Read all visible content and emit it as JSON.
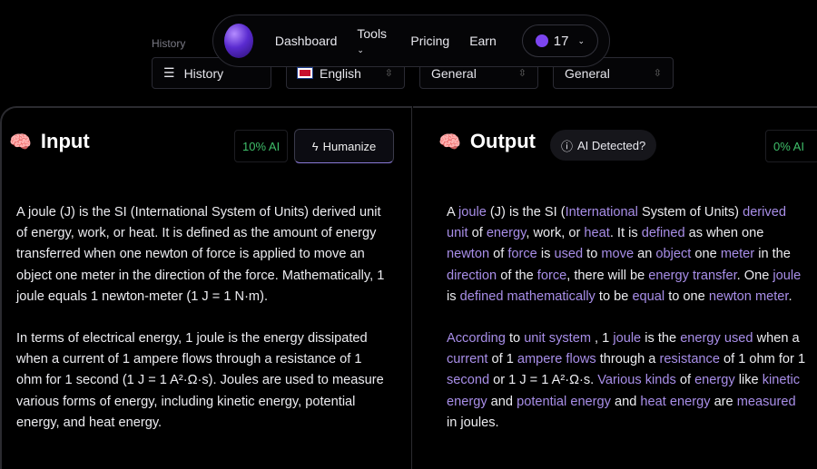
{
  "toolbar": {
    "history_label": "History",
    "history_button": "History",
    "language": "English",
    "mode1": "General",
    "mode2": "General"
  },
  "nav": {
    "items": [
      "Dashboard",
      "Tools",
      "Pricing",
      "Earn"
    ],
    "credits": "17"
  },
  "input": {
    "title": "Input",
    "ai_score": "10% AI",
    "humanize": "Humanize",
    "paragraphs": [
      "A joule (J) is the SI (International System of Units) derived unit of energy, work, or heat. It is defined as the amount of energy transferred when one newton of force is applied to move an object one meter in the direction of the force. Mathematically, 1 joule equals 1 newton-meter (1 J = 1 N·m).",
      "In terms of electrical energy, 1 joule is the energy dissipated when a current of 1 ampere flows through a resistance of 1 ohm for 1 second (1 J = 1 A²·Ω·s). Joules are used to measure various forms of energy, including kinetic energy, potential energy, and heat energy."
    ]
  },
  "output": {
    "title": "Output",
    "ai_detected": "AI Detected?",
    "ai_score": "0% AI",
    "paragraphs": [
      [
        [
          "A ",
          0
        ],
        [
          "joule",
          1
        ],
        [
          " (J) is the SI (",
          0
        ],
        [
          "International",
          1
        ],
        [
          " System of Units) ",
          0
        ],
        [
          "derived",
          1
        ],
        [
          " ",
          0
        ],
        [
          "unit",
          1
        ],
        [
          " of ",
          0
        ],
        [
          "energy",
          1
        ],
        [
          ", work, or ",
          0
        ],
        [
          "heat",
          1
        ],
        [
          ". It is ",
          0
        ],
        [
          "defined",
          1
        ],
        [
          " as when one ",
          0
        ],
        [
          "newton",
          1
        ],
        [
          " of ",
          0
        ],
        [
          "force",
          1
        ],
        [
          " is ",
          0
        ],
        [
          "used",
          1
        ],
        [
          " to ",
          0
        ],
        [
          "move",
          1
        ],
        [
          " an ",
          0
        ],
        [
          "object",
          1
        ],
        [
          " one ",
          0
        ],
        [
          "meter",
          1
        ],
        [
          " in the ",
          0
        ],
        [
          "direction",
          1
        ],
        [
          " of the ",
          0
        ],
        [
          "force",
          1
        ],
        [
          ", there will be ",
          0
        ],
        [
          "energy transfer",
          1
        ],
        [
          ". One ",
          0
        ],
        [
          "joule",
          1
        ],
        [
          " is ",
          0
        ],
        [
          "defined mathematically",
          1
        ],
        [
          " to be ",
          0
        ],
        [
          "equal",
          1
        ],
        [
          " to one ",
          0
        ],
        [
          "newton meter",
          1
        ],
        [
          ".",
          0
        ]
      ],
      [
        [
          "According",
          1
        ],
        [
          " to ",
          0
        ],
        [
          "unit system",
          1
        ],
        [
          " , 1 ",
          0
        ],
        [
          "joule",
          1
        ],
        [
          " is the ",
          0
        ],
        [
          "energy used",
          1
        ],
        [
          " when a ",
          0
        ],
        [
          "current",
          1
        ],
        [
          " of 1 ",
          0
        ],
        [
          "ampere flows",
          1
        ],
        [
          " through a ",
          0
        ],
        [
          "resistance",
          1
        ],
        [
          " of 1 ohm for 1 ",
          0
        ],
        [
          "second",
          1
        ],
        [
          " or 1 J = 1 A²·Ω·s. ",
          0
        ],
        [
          "Various kinds",
          1
        ],
        [
          " of ",
          0
        ],
        [
          "energy",
          1
        ],
        [
          " like ",
          0
        ],
        [
          "kinetic energy",
          1
        ],
        [
          " and ",
          0
        ],
        [
          "potential energy",
          1
        ],
        [
          " and ",
          0
        ],
        [
          "heat energy",
          1
        ],
        [
          " are ",
          0
        ],
        [
          "measured",
          1
        ],
        [
          " in joules.",
          0
        ]
      ]
    ]
  },
  "colors": {
    "highlight": "#a88ee8",
    "ai_score": "#3fbf6a",
    "accent": "#7c45f0"
  }
}
